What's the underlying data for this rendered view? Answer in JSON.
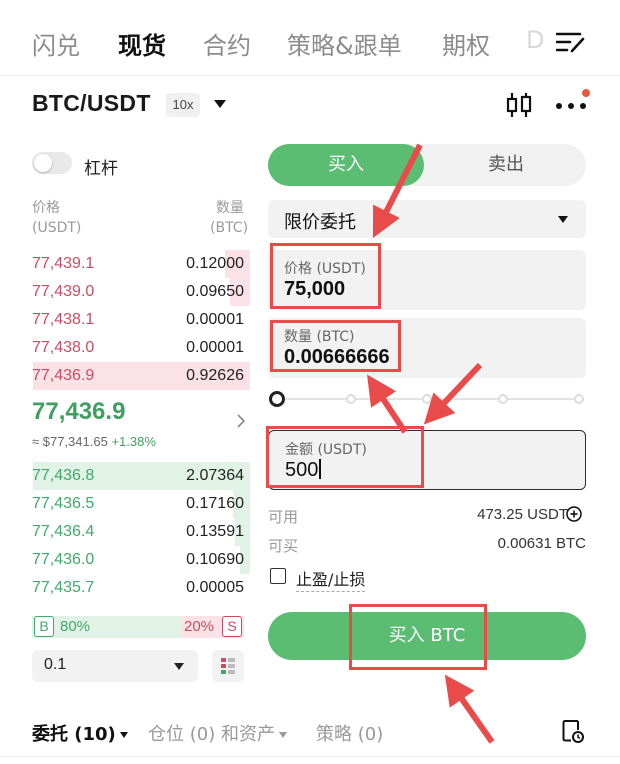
{
  "top_tabs": [
    {
      "label": "闪兑"
    },
    {
      "label": "现货"
    },
    {
      "label": "合约"
    },
    {
      "label": "策略&跟单"
    },
    {
      "label": "期权"
    },
    {
      "label": "D"
    }
  ],
  "pair": {
    "symbol": "BTC/USDT",
    "leverage_badge": "10x"
  },
  "leverage_toggle": {
    "label": "杠杆",
    "on": false
  },
  "order_book": {
    "price_header": [
      "价格",
      "(USDT)"
    ],
    "qty_header": [
      "数量",
      "(BTC)"
    ],
    "asks": [
      {
        "price": "77,439.1",
        "qty": "0.12000",
        "depth": 0.1
      },
      {
        "price": "77,439.0",
        "qty": "0.09650",
        "depth": 0.08
      },
      {
        "price": "77,438.1",
        "qty": "0.00001",
        "depth": 0.0
      },
      {
        "price": "77,438.0",
        "qty": "0.00001",
        "depth": 0.0
      },
      {
        "price": "77,436.9",
        "qty": "0.92626",
        "depth": 0.87
      }
    ],
    "mid_price": "77,436.9",
    "mid_fiat": "≈ $77,341.65",
    "mid_change": "+1.38%",
    "bids": [
      {
        "price": "77,436.8",
        "qty": "2.07364",
        "depth": 0.87
      },
      {
        "price": "77,436.5",
        "qty": "0.17160",
        "depth": 0.07
      },
      {
        "price": "77,436.4",
        "qty": "0.13591",
        "depth": 0.06
      },
      {
        "price": "77,436.0",
        "qty": "0.10690",
        "depth": 0.04
      },
      {
        "price": "77,435.7",
        "qty": "0.00005",
        "depth": 0.0
      }
    ],
    "ratio": {
      "buy_badge": "B",
      "buy_pct": "80%",
      "sell_pct": "20%",
      "sell_badge": "S"
    },
    "depth_value": "0.1"
  },
  "trade": {
    "buy_label": "买入",
    "sell_label": "卖出",
    "order_type": "限价委托",
    "price_label": "价格 (USDT)",
    "price_value": "75,000",
    "qty_label": "数量 (BTC)",
    "qty_value": "0.00666666",
    "amount_label": "金额 (USDT)",
    "amount_value": "500",
    "available_label": "可用",
    "available_value": "473.25 USDT",
    "can_buy_label": "可买",
    "can_buy_value": "0.00631 BTC",
    "tpsl_label": "止盈/止损",
    "submit_label": "买入 BTC"
  },
  "bottom_tabs": [
    {
      "label": "委托 (10)"
    },
    {
      "label": "仓位 (0) 和资产"
    },
    {
      "label": "策略 (0)"
    }
  ],
  "colors": {
    "buy": "#5bbd71",
    "ask": "#c94d61",
    "bid": "#42a86b",
    "annotation": "#e94b4b"
  }
}
